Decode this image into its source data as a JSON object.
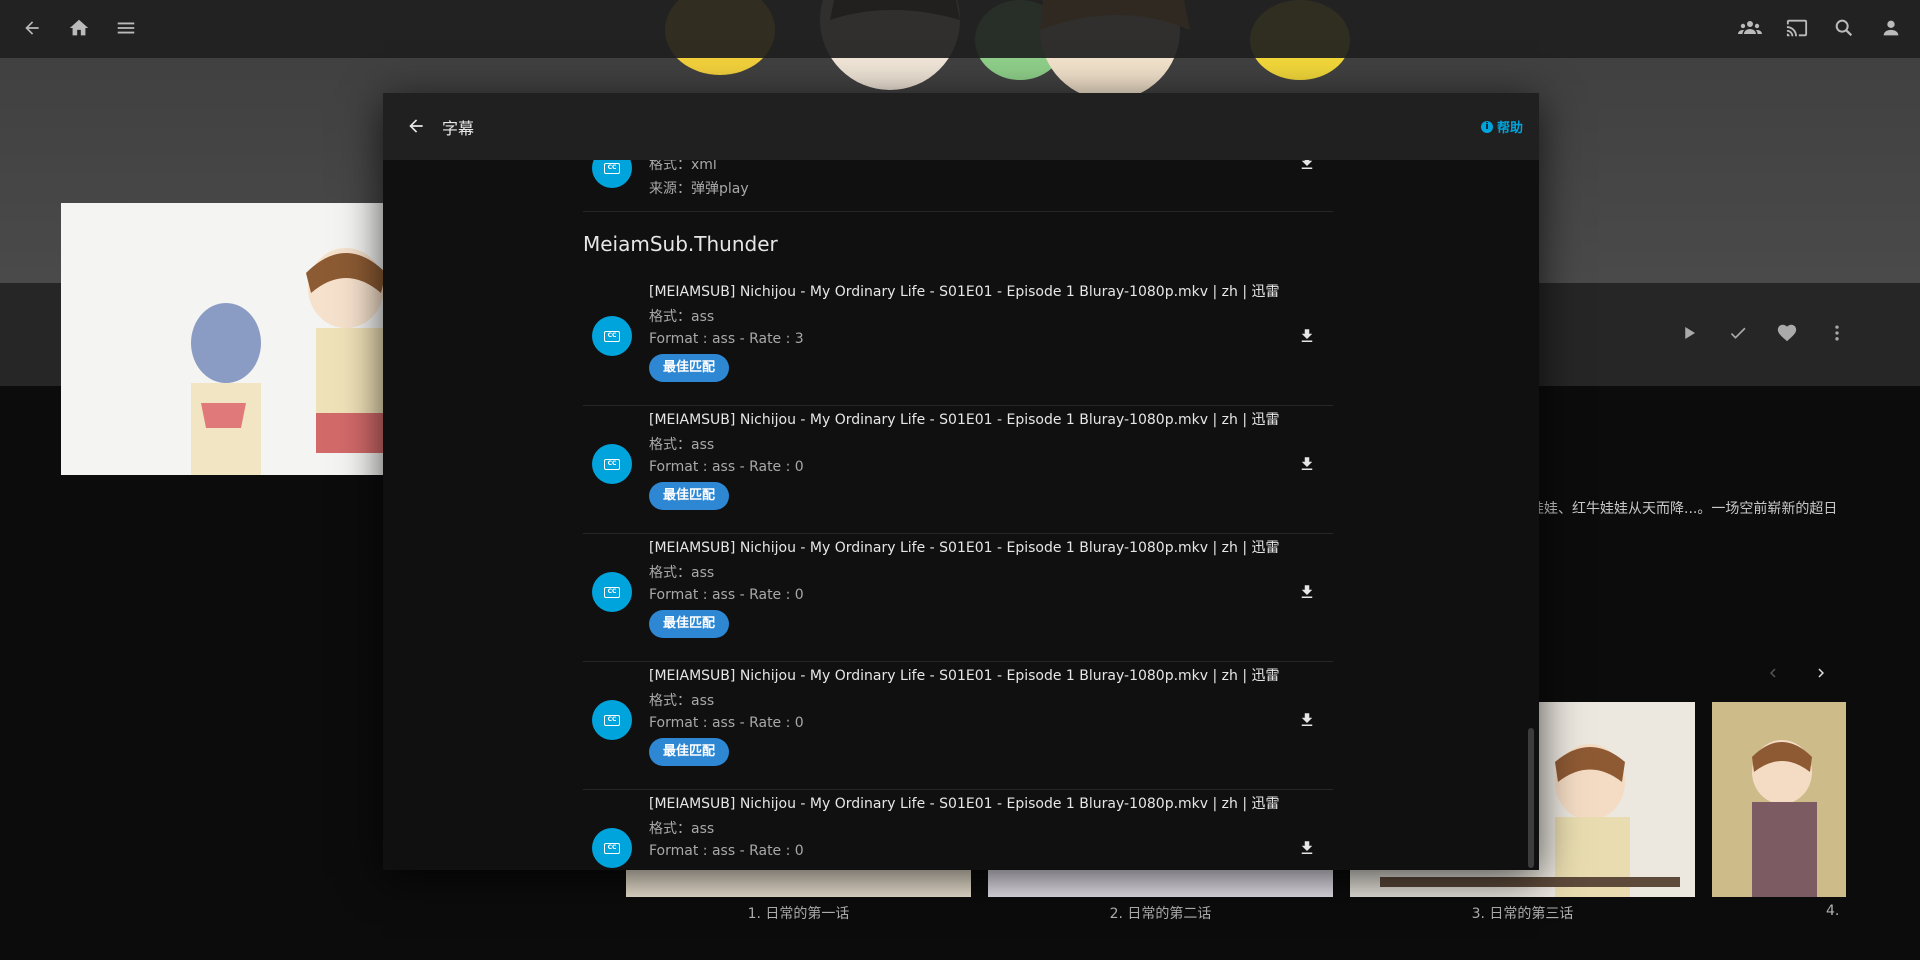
{
  "topbar": {
    "back_icon": "arrow-back-icon",
    "home_icon": "home-icon",
    "menu_icon": "menu-icon",
    "right_icons": [
      "people-icon",
      "cast-icon",
      "search-icon",
      "user-icon"
    ]
  },
  "background": {
    "actions": [
      "play-icon",
      "check-icon",
      "heart-icon",
      "more-vert-icon"
    ],
    "overview_fragment": "娃娃、红牛娃娃从天而降...。一场空前崭新的超日",
    "episodes": [
      {
        "title": "1. 日常的第一话"
      },
      {
        "title": "2. 日常的第二话"
      },
      {
        "title": "3. 日常的第三话"
      },
      {
        "title": "4."
      }
    ]
  },
  "dialog": {
    "title": "字幕",
    "help_label": "帮助",
    "partial_item": {
      "format_line": "格式：xml",
      "source_line": "来源：弹弹play"
    },
    "group_title": "MeiamSub.Thunder",
    "items": [
      {
        "name": "[MEIAMSUB] Nichijou - My Ordinary Life - S01E01 - Episode 1 Bluray-1080p.mkv | zh | 迅雷",
        "format_cn": "格式：ass",
        "format_rate": "Format : ass - Rate : 3",
        "badge": "最佳匹配"
      },
      {
        "name": "[MEIAMSUB] Nichijou - My Ordinary Life - S01E01 - Episode 1 Bluray-1080p.mkv | zh | 迅雷",
        "format_cn": "格式：ass",
        "format_rate": "Format : ass - Rate : 0",
        "badge": "最佳匹配"
      },
      {
        "name": "[MEIAMSUB] Nichijou - My Ordinary Life - S01E01 - Episode 1 Bluray-1080p.mkv | zh | 迅雷",
        "format_cn": "格式：ass",
        "format_rate": "Format : ass - Rate : 0",
        "badge": "最佳匹配"
      },
      {
        "name": "[MEIAMSUB] Nichijou - My Ordinary Life - S01E01 - Episode 1 Bluray-1080p.mkv | zh | 迅雷",
        "format_cn": "格式：ass",
        "format_rate": "Format : ass - Rate : 0",
        "badge": "最佳匹配"
      },
      {
        "name": "[MEIAMSUB] Nichijou - My Ordinary Life - S01E01 - Episode 1 Bluray-1080p.mkv | zh | 迅雷",
        "format_cn": "格式：ass",
        "format_rate": "Format : ass - Rate : 0"
      }
    ]
  },
  "colors": {
    "accent": "#00a4dc",
    "badge": "#2d87d3",
    "dialog_bg": "#101010",
    "header_bg": "#202020"
  }
}
